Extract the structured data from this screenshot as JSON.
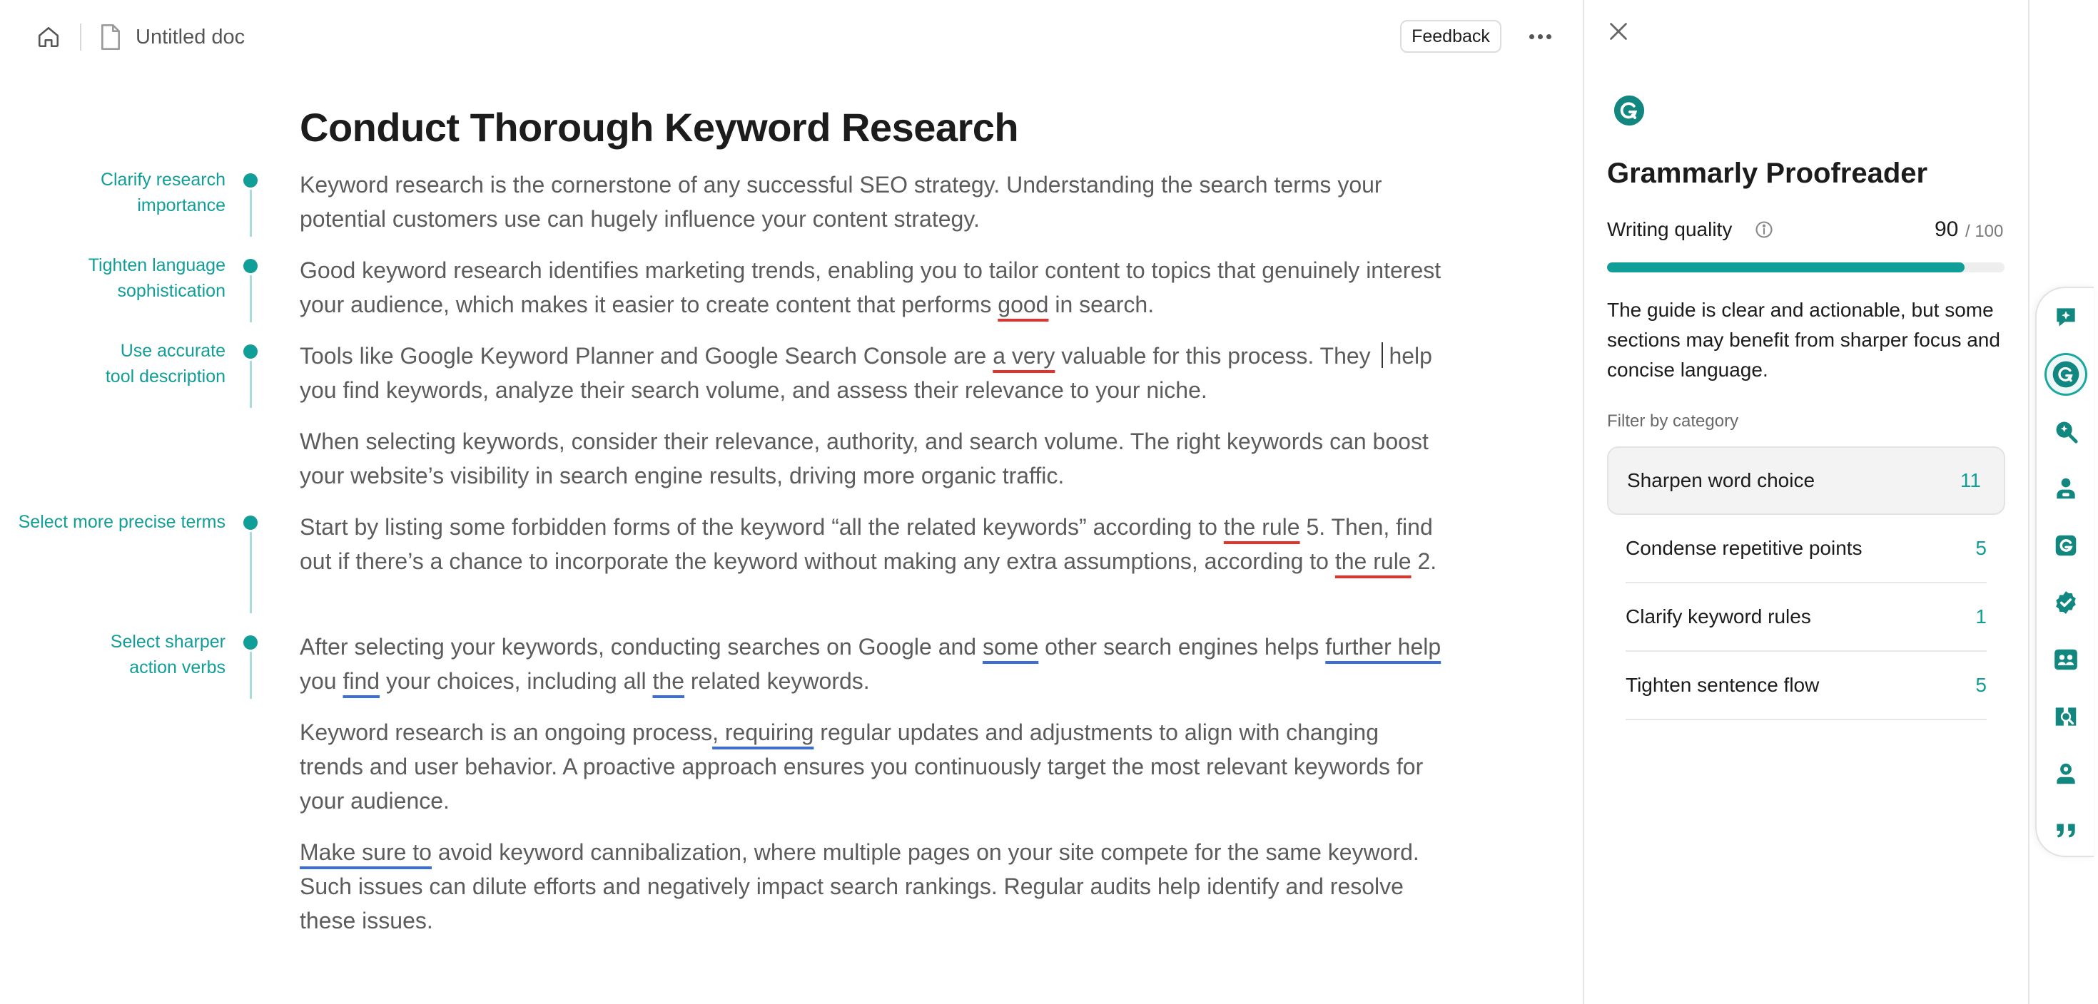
{
  "topbar": {
    "doc_title": "Untitled doc",
    "feedback_label": "Feedback",
    "icons": [
      "home-icon",
      "document-icon",
      "more-icon"
    ]
  },
  "document": {
    "heading": "Conduct Thorough Keyword Research",
    "paragraphs": [
      {
        "segments": [
          {
            "text": "Keyword research is the cornerstone of any successful SEO strategy. Understanding the search terms your potential customers use can hugely influence your content strategy."
          }
        ]
      },
      {
        "segments": [
          {
            "text": "Good keyword research identifies marketing trends, enabling you to tailor content to topics that genuinely interest your audience, which makes it easier to create content that performs "
          },
          {
            "text": "good",
            "mark": "red"
          },
          {
            "text": " in search."
          }
        ]
      },
      {
        "segments": [
          {
            "text": "Tools like Google Keyword Planner and Google Search Console are "
          },
          {
            "text": "a very",
            "mark": "red"
          },
          {
            "text": " valuable for this process. They "
          },
          {
            "text": "",
            "mark": "caret"
          },
          {
            "text": " help you find keywords, analyze their search volume, and assess their relevance to your niche."
          }
        ]
      },
      {
        "segments": [
          {
            "text": "When selecting keywords, consider their relevance, authority, and search volume. The right keywords can boost your website’s visibility in search engine results, driving more organic traffic."
          }
        ]
      },
      {
        "segments": [
          {
            "text": "Start by listing some forbidden forms of the keyword “all the related keywords” according to "
          },
          {
            "text": "the rule",
            "mark": "red"
          },
          {
            "text": " 5. Then, find out if there’s a chance to incorporate the keyword without making any extra assumptions, according to "
          },
          {
            "text": "the rule",
            "mark": "red"
          },
          {
            "text": " 2."
          }
        ]
      },
      {
        "segments": [
          {
            "text": "After selecting your keywords, conducting searches on Google and "
          },
          {
            "text": "some",
            "mark": "blue"
          },
          {
            "text": " other search engines helps "
          },
          {
            "text": "further help",
            "mark": "blue"
          },
          {
            "text": " you "
          },
          {
            "text": "find",
            "mark": "blue"
          },
          {
            "text": " your choices, including all "
          },
          {
            "text": "the",
            "mark": "blue"
          },
          {
            "text": " related keywords."
          }
        ]
      },
      {
        "segments": [
          {
            "text": "Keyword research is an ongoing process"
          },
          {
            "text": ", requiring",
            "mark": "blue"
          },
          {
            "text": " regular updates and adjustments to align with changing trends and user behavior. A proactive approach ensures you continuously target the most relevant keywords for your audience."
          }
        ]
      },
      {
        "segments": [
          {
            "text": "Make sure to",
            "mark": "blue"
          },
          {
            "text": " avoid keyword cannibalization, where multiple pages on your site compete for the same keyword. Such issues can dilute efforts and negatively impact search rankings. Regular audits help identify and resolve these issues."
          }
        ]
      }
    ]
  },
  "suggestions": [
    {
      "lines": [
        "Clarify research",
        "importance"
      ]
    },
    {
      "lines": [
        "Tighten language",
        "sophistication"
      ]
    },
    {
      "lines": [
        "Use accurate",
        "tool description"
      ]
    },
    {
      "lines": [
        "Select more precise terms"
      ]
    },
    {
      "lines": [
        "Select sharper",
        "action verbs"
      ]
    }
  ],
  "panel": {
    "title": "Grammarly Proofreader",
    "writing_quality_label": "Writing quality",
    "score": "90",
    "score_max": "/ 100",
    "score_fraction": 0.9,
    "summary": "The guide is clear and actionable, but some sections may benefit from sharper focus and concise language.",
    "filter_label": "Filter by category",
    "categories": [
      {
        "name": "Sharpen word choice",
        "count": "11",
        "active": true
      },
      {
        "name": "Condense repetitive points",
        "count": "5",
        "active": false
      },
      {
        "name": "Clarify keyword rules",
        "count": "1",
        "active": false
      },
      {
        "name": "Tighten sentence flow",
        "count": "5",
        "active": false
      }
    ]
  },
  "toolbar": {
    "icons": [
      "ai-chat-icon",
      "grammarly-icon",
      "search-insight-icon",
      "reader-icon",
      "paraphrase-icon",
      "verified-icon",
      "audience-icon",
      "plagiarism-icon",
      "expert-icon",
      "citation-icon"
    ],
    "active_index": 1
  },
  "colors": {
    "accent": "#129e98",
    "error_underline": "#e0332b",
    "clarity_underline": "#3b6fd6"
  }
}
